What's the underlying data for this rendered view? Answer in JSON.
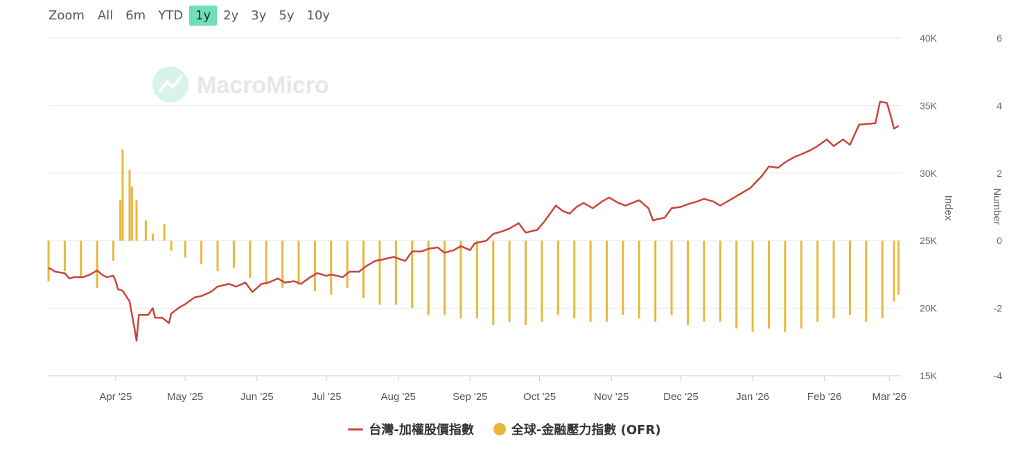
{
  "zoom": {
    "label": "Zoom",
    "options": [
      "All",
      "6m",
      "YTD",
      "1y",
      "2y",
      "3y",
      "5y",
      "10y"
    ],
    "active": "1y"
  },
  "watermark": "MacroMicro",
  "colors": {
    "index_line": "#c9453a",
    "ofr_bar": "#e8b83a",
    "grid": "#e4e4e4",
    "active_zoom": "#6fdfb8"
  },
  "legend": {
    "series1": "台灣-加權股價指數",
    "series2": "全球-金融壓力指數 (OFR)"
  },
  "chart_data": {
    "type": "line+bar",
    "x_ticks": [
      "Apr '25",
      "May '25",
      "Jun '25",
      "Jul '25",
      "Aug '25",
      "Sep '25",
      "Oct '25",
      "Nov '25",
      "Dec '25",
      "Jan '26",
      "Feb '26",
      "Mar '26"
    ],
    "y_left": {
      "label": "Index",
      "ticks": [
        "40K",
        "35K",
        "30K",
        "25K",
        "20K",
        "15K"
      ],
      "range": [
        15000,
        40000
      ]
    },
    "y_right": {
      "label": "Number",
      "ticks": [
        "6",
        "4",
        "2",
        "0",
        "-2",
        "-4"
      ],
      "range": [
        -4,
        6
      ]
    },
    "grid": true,
    "legend_position": "bottom",
    "series": [
      {
        "name": "台灣-加權股價指數",
        "kind": "line",
        "axis": "left",
        "points": [
          [
            "2025-03-03",
            23000
          ],
          [
            "2025-03-06",
            22700
          ],
          [
            "2025-03-10",
            22600
          ],
          [
            "2025-03-12",
            22200
          ],
          [
            "2025-03-14",
            22300
          ],
          [
            "2025-03-18",
            22300
          ],
          [
            "2025-03-21",
            22500
          ],
          [
            "2025-03-24",
            22800
          ],
          [
            "2025-03-26",
            22500
          ],
          [
            "2025-03-28",
            22300
          ],
          [
            "2025-03-31",
            22400
          ],
          [
            "2025-04-01",
            22000
          ],
          [
            "2025-04-02",
            21400
          ],
          [
            "2025-04-04",
            21300
          ],
          [
            "2025-04-07",
            20500
          ],
          [
            "2025-04-09",
            18600
          ],
          [
            "2025-04-10",
            17600
          ],
          [
            "2025-04-11",
            19500
          ],
          [
            "2025-04-15",
            19500
          ],
          [
            "2025-04-17",
            20000
          ],
          [
            "2025-04-18",
            19300
          ],
          [
            "2025-04-21",
            19300
          ],
          [
            "2025-04-24",
            18900
          ],
          [
            "2025-04-25",
            19600
          ],
          [
            "2025-04-28",
            20000
          ],
          [
            "2025-05-01",
            20300
          ],
          [
            "2025-05-05",
            20800
          ],
          [
            "2025-05-08",
            20900
          ],
          [
            "2025-05-12",
            21200
          ],
          [
            "2025-05-15",
            21600
          ],
          [
            "2025-05-20",
            21800
          ],
          [
            "2025-05-23",
            21600
          ],
          [
            "2025-05-27",
            21900
          ],
          [
            "2025-05-30",
            21200
          ],
          [
            "2025-06-03",
            21800
          ],
          [
            "2025-06-06",
            21900
          ],
          [
            "2025-06-10",
            22200
          ],
          [
            "2025-06-13",
            21900
          ],
          [
            "2025-06-17",
            22000
          ],
          [
            "2025-06-20",
            21800
          ],
          [
            "2025-06-24",
            22300
          ],
          [
            "2025-06-27",
            22600
          ],
          [
            "2025-07-01",
            22400
          ],
          [
            "2025-07-03",
            22500
          ],
          [
            "2025-07-08",
            22300
          ],
          [
            "2025-07-11",
            22700
          ],
          [
            "2025-07-15",
            22700
          ],
          [
            "2025-07-18",
            23100
          ],
          [
            "2025-07-22",
            23500
          ],
          [
            "2025-07-25",
            23600
          ],
          [
            "2025-07-30",
            23800
          ],
          [
            "2025-08-04",
            23500
          ],
          [
            "2025-08-07",
            24200
          ],
          [
            "2025-08-11",
            24200
          ],
          [
            "2025-08-14",
            24400
          ],
          [
            "2025-08-18",
            24500
          ],
          [
            "2025-08-21",
            24100
          ],
          [
            "2025-08-25",
            24300
          ],
          [
            "2025-08-28",
            24600
          ],
          [
            "2025-09-01",
            24300
          ],
          [
            "2025-09-03",
            24800
          ],
          [
            "2025-09-08",
            25000
          ],
          [
            "2025-09-11",
            25500
          ],
          [
            "2025-09-15",
            25700
          ],
          [
            "2025-09-18",
            25900
          ],
          [
            "2025-09-22",
            26300
          ],
          [
            "2025-09-25",
            25600
          ],
          [
            "2025-09-30",
            25800
          ],
          [
            "2025-10-03",
            26400
          ],
          [
            "2025-10-08",
            27600
          ],
          [
            "2025-10-11",
            27200
          ],
          [
            "2025-10-14",
            27000
          ],
          [
            "2025-10-17",
            27500
          ],
          [
            "2025-10-20",
            27800
          ],
          [
            "2025-10-24",
            27400
          ],
          [
            "2025-10-28",
            27900
          ],
          [
            "2025-10-31",
            28200
          ],
          [
            "2025-11-04",
            27800
          ],
          [
            "2025-11-07",
            27600
          ],
          [
            "2025-11-10",
            27800
          ],
          [
            "2025-11-13",
            28000
          ],
          [
            "2025-11-17",
            27400
          ],
          [
            "2025-11-19",
            26500
          ],
          [
            "2025-11-21",
            26600
          ],
          [
            "2025-11-24",
            26700
          ],
          [
            "2025-11-27",
            27400
          ],
          [
            "2025-12-01",
            27500
          ],
          [
            "2025-12-04",
            27700
          ],
          [
            "2025-12-08",
            27900
          ],
          [
            "2025-12-11",
            28100
          ],
          [
            "2025-12-15",
            27900
          ],
          [
            "2025-12-18",
            27600
          ],
          [
            "2025-12-22",
            28000
          ],
          [
            "2025-12-26",
            28400
          ],
          [
            "2025-12-31",
            28900
          ],
          [
            "2026-01-05",
            29800
          ],
          [
            "2026-01-08",
            30500
          ],
          [
            "2026-01-12",
            30400
          ],
          [
            "2026-01-15",
            30800
          ],
          [
            "2026-01-19",
            31200
          ],
          [
            "2026-01-22",
            31400
          ],
          [
            "2026-01-26",
            31700
          ],
          [
            "2026-01-29",
            32000
          ],
          [
            "2026-02-02",
            32500
          ],
          [
            "2026-02-05",
            32000
          ],
          [
            "2026-02-09",
            32500
          ],
          [
            "2026-02-12",
            32100
          ],
          [
            "2026-02-16",
            33600
          ],
          [
            "2026-02-23",
            33700
          ],
          [
            "2026-02-25",
            35300
          ],
          [
            "2026-02-28",
            35200
          ],
          [
            "2026-03-02",
            34000
          ],
          [
            "2026-03-03",
            33300
          ],
          [
            "2026-03-05",
            33500
          ]
        ]
      },
      {
        "name": "全球-金融壓力指數 (OFR)",
        "kind": "bar",
        "axis": "right",
        "points": [
          [
            "2025-03-03",
            -1.2
          ],
          [
            "2025-03-10",
            -0.9
          ],
          [
            "2025-03-17",
            -1.1
          ],
          [
            "2025-03-24",
            -1.4
          ],
          [
            "2025-03-31",
            -0.6
          ],
          [
            "2025-04-03",
            1.2
          ],
          [
            "2025-04-04",
            2.7
          ],
          [
            "2025-04-07",
            2.1
          ],
          [
            "2025-04-08",
            1.6
          ],
          [
            "2025-04-10",
            1.2
          ],
          [
            "2025-04-14",
            0.6
          ],
          [
            "2025-04-17",
            0.2
          ],
          [
            "2025-04-22",
            0.5
          ],
          [
            "2025-04-25",
            -0.3
          ],
          [
            "2025-05-01",
            -0.5
          ],
          [
            "2025-05-08",
            -0.7
          ],
          [
            "2025-05-15",
            -0.9
          ],
          [
            "2025-05-22",
            -0.8
          ],
          [
            "2025-05-29",
            -1.1
          ],
          [
            "2025-06-05",
            -1.3
          ],
          [
            "2025-06-12",
            -1.4
          ],
          [
            "2025-06-19",
            -1.3
          ],
          [
            "2025-06-26",
            -1.5
          ],
          [
            "2025-07-03",
            -1.6
          ],
          [
            "2025-07-10",
            -1.4
          ],
          [
            "2025-07-17",
            -1.7
          ],
          [
            "2025-07-24",
            -1.9
          ],
          [
            "2025-07-31",
            -1.9
          ],
          [
            "2025-08-07",
            -2.0
          ],
          [
            "2025-08-14",
            -2.2
          ],
          [
            "2025-08-21",
            -2.2
          ],
          [
            "2025-08-28",
            -2.3
          ],
          [
            "2025-09-04",
            -2.3
          ],
          [
            "2025-09-11",
            -2.5
          ],
          [
            "2025-09-18",
            -2.4
          ],
          [
            "2025-09-25",
            -2.5
          ],
          [
            "2025-10-02",
            -2.4
          ],
          [
            "2025-10-09",
            -2.2
          ],
          [
            "2025-10-16",
            -2.3
          ],
          [
            "2025-10-23",
            -2.4
          ],
          [
            "2025-10-30",
            -2.4
          ],
          [
            "2025-11-06",
            -2.2
          ],
          [
            "2025-11-13",
            -2.3
          ],
          [
            "2025-11-20",
            -2.4
          ],
          [
            "2025-11-27",
            -2.2
          ],
          [
            "2025-12-04",
            -2.5
          ],
          [
            "2025-12-11",
            -2.4
          ],
          [
            "2025-12-18",
            -2.4
          ],
          [
            "2025-12-25",
            -2.6
          ],
          [
            "2026-01-01",
            -2.7
          ],
          [
            "2026-01-08",
            -2.6
          ],
          [
            "2026-01-15",
            -2.7
          ],
          [
            "2026-01-22",
            -2.6
          ],
          [
            "2026-01-29",
            -2.4
          ],
          [
            "2026-02-05",
            -2.3
          ],
          [
            "2026-02-12",
            -2.2
          ],
          [
            "2026-02-19",
            -2.4
          ],
          [
            "2026-02-26",
            -2.3
          ],
          [
            "2026-03-03",
            -1.8
          ],
          [
            "2026-03-05",
            -1.6
          ]
        ]
      }
    ]
  }
}
